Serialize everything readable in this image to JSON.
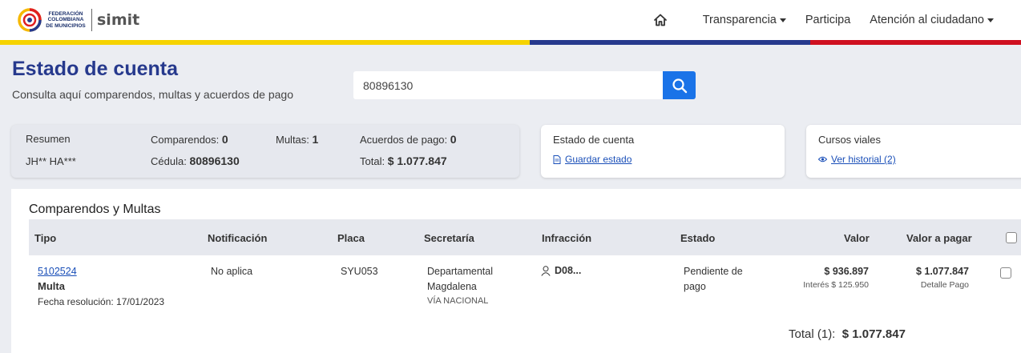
{
  "header": {
    "logo_text_lines": [
      "FEDERACIÓN",
      "COLOMBIANA",
      "DE MUNICIPIOS"
    ],
    "logo_brand": "simit",
    "nav": {
      "home_icon": "home-icon",
      "items": [
        {
          "label": "Transparencia",
          "dropdown": true
        },
        {
          "label": "Participa",
          "dropdown": false
        },
        {
          "label": "Atención al ciudadano",
          "dropdown": true
        }
      ]
    },
    "flag_colors": [
      "#f6d300",
      "#26398d",
      "#cf1020"
    ]
  },
  "page": {
    "title": "Estado de cuenta",
    "subtitle": "Consulta aquí comparendos, multas y acuerdos de pago"
  },
  "search": {
    "value": "80896130",
    "icon": "search-icon"
  },
  "resumen": {
    "label": "Resumen",
    "name": "JH** HA***",
    "comparendos_label": "Comparendos:",
    "comparendos_value": "0",
    "cedula_label": "Cédula:",
    "cedula_value": "80896130",
    "multas_label": "Multas:",
    "multas_value": "1",
    "acuerdos_label": "Acuerdos de pago:",
    "acuerdos_value": "0",
    "total_label": "Total:",
    "total_value": "$ 1.077.847"
  },
  "estado_card": {
    "title": "Estado de cuenta",
    "link": "Guardar estado"
  },
  "cursos_card": {
    "title": "Cursos viales",
    "link": "Ver historial (2)"
  },
  "table": {
    "title": "Comparendos y Multas",
    "headers": {
      "tipo": "Tipo",
      "notificacion": "Notificación",
      "placa": "Placa",
      "secretaria": "Secretaría",
      "infraccion": "Infracción",
      "estado": "Estado",
      "valor": "Valor",
      "valor_pagar": "Valor a pagar"
    },
    "rows": [
      {
        "numero": "5102524",
        "tipo": "Multa",
        "fecha_resolucion": "Fecha resolución: 17/01/2023",
        "notificacion": "No aplica",
        "placa": "SYU053",
        "secretaria_1": "Departamental",
        "secretaria_2": "Magdalena",
        "secretaria_3": "VÍA NACIONAL",
        "infraccion": "D08...",
        "estado_1": "Pendiente de",
        "estado_2": "pago",
        "valor": "$ 936.897",
        "interes": "Interés $ 125.950",
        "valor_pagar": "$ 1.077.847",
        "detalle": "Detalle Pago"
      }
    ],
    "total_label": "Total (1):",
    "total_value": "$ 1.077.847"
  }
}
